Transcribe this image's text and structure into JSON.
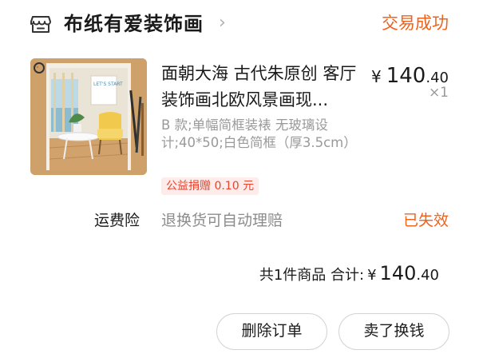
{
  "shop": {
    "name": "布纸有爱装饰画",
    "icon": "store-icon",
    "arrow": "›"
  },
  "order": {
    "status": "交易成功"
  },
  "item": {
    "title": "面朝大海 古代朱原创 客厅装饰画北欧风景画现...",
    "price_currency": "¥",
    "price_int": "140",
    "price_dec": ".40",
    "quantity": "×1",
    "spec": "B 款;单幅简框装裱 无玻璃设计;40*50;白色简框（厚3.5cm）",
    "charity": "公益捐赠 0.10 元",
    "thumbnail_text": "LET'S START"
  },
  "insurance": {
    "label": "运费险",
    "description": "退换货可自动理赔",
    "status": "已失效"
  },
  "total": {
    "summary": "共1件商品 合计:",
    "currency": "¥",
    "amount_int": "140",
    "amount_dec": ".40"
  },
  "actions": {
    "delete_label": "删除订单",
    "resell_label": "卖了换钱"
  },
  "colors": {
    "accent": "#f0621b",
    "charity_text": "#e8432e",
    "charity_bg": "#fdecea"
  }
}
